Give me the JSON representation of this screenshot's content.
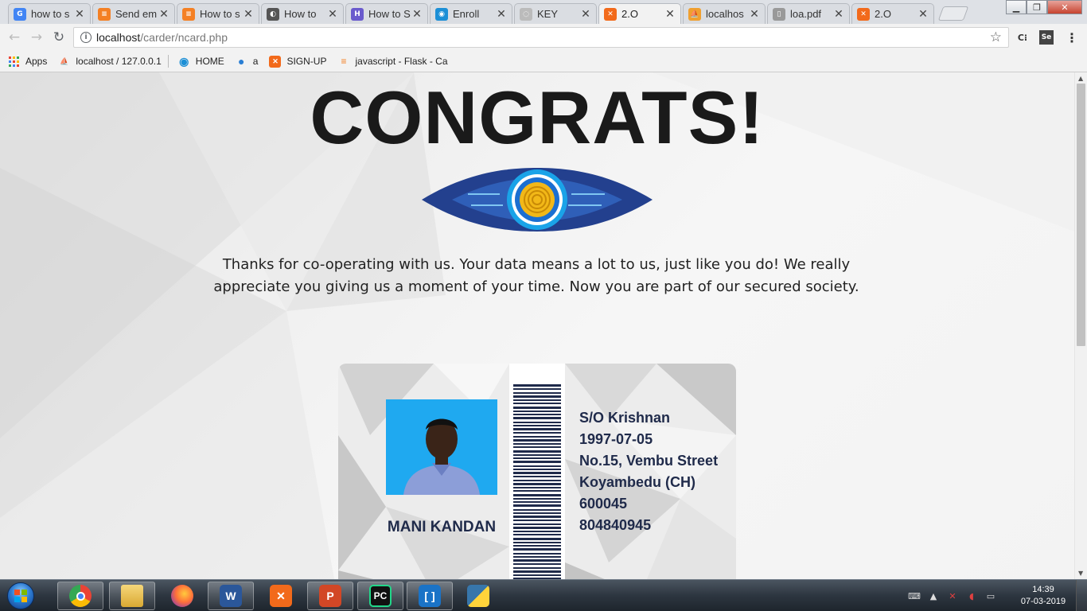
{
  "browser": {
    "tabs": [
      {
        "title": "how to s",
        "icon": "google-icon",
        "color": "#4285f4",
        "glyph": "G"
      },
      {
        "title": "Send em",
        "icon": "stackoverflow-icon",
        "color": "#f48024",
        "glyph": "≡"
      },
      {
        "title": "How to s",
        "icon": "stackoverflow-icon",
        "color": "#f48024",
        "glyph": "≡"
      },
      {
        "title": "How to",
        "icon": "github-icon",
        "color": "#555555",
        "glyph": "◐"
      },
      {
        "title": "How to S",
        "icon": "site-icon",
        "color": "#6a5acd",
        "glyph": "H"
      },
      {
        "title": "Enroll",
        "icon": "eye-logo-icon",
        "color": "#1c8fd6",
        "glyph": "◉"
      },
      {
        "title": "KEY",
        "icon": "loading-icon",
        "color": "#bbbbbb",
        "glyph": "◌"
      },
      {
        "title": "2.O",
        "icon": "xampp-icon",
        "color": "#f26a1b",
        "glyph": "✕",
        "active": true
      },
      {
        "title": "localhos",
        "icon": "phpmyadmin-icon",
        "color": "#f0a030",
        "glyph": "⛵"
      },
      {
        "title": "loa.pdf",
        "icon": "file-icon",
        "color": "#999999",
        "glyph": "▯"
      },
      {
        "title": "2.O",
        "icon": "xampp-icon",
        "color": "#f26a1b",
        "glyph": "✕"
      }
    ],
    "address": {
      "host": "localhost",
      "path": "/carder/ncard.php"
    },
    "bookmarks": [
      {
        "label": "Apps",
        "icon": "apps-grid-icon"
      },
      {
        "label": "localhost / 127.0.0.1",
        "icon": "phpmyadmin-icon"
      },
      {
        "label": "HOME",
        "icon": "eye-logo-icon"
      },
      {
        "label": "a",
        "icon": "globe-icon"
      },
      {
        "label": "SIGN-UP",
        "icon": "xampp-icon"
      },
      {
        "label": "javascript - Flask - Ca",
        "icon": "stackoverflow-icon"
      }
    ]
  },
  "page": {
    "heading": "CONGRATS!",
    "message": "Thanks for co-operating with us. Your data means a lot to us, just like you do! We really appreciate you giving us a moment of your time. Now you are part of our secured society.",
    "card": {
      "name": "MANI KANDAN",
      "details": [
        "S/O Krishnan",
        "1997-07-05",
        "No.15, Vembu Street",
        "Koyambedu (CH)",
        "600045",
        "804840945"
      ]
    }
  },
  "taskbar": {
    "apps": [
      "chrome-icon",
      "explorer-icon",
      "firefox-icon",
      "word-icon",
      "xampp-icon",
      "powerpoint-icon",
      "pycharm-icon",
      "brackets-icon",
      "python-icon"
    ],
    "time": "14:39",
    "date": "07-03-2019"
  }
}
